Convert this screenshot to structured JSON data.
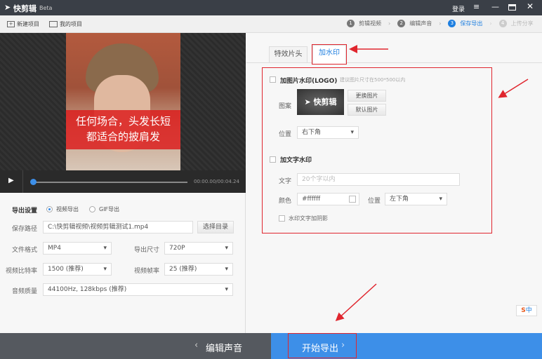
{
  "app": {
    "name": "快剪辑",
    "badge": "Beta",
    "login": "登录"
  },
  "toolbar": {
    "new_project": "新建项目",
    "my_projects": "我的项目"
  },
  "steps": [
    {
      "num": "1",
      "label": "剪辑视频"
    },
    {
      "num": "2",
      "label": "编辑声音"
    },
    {
      "num": "3",
      "label": "保存导出"
    },
    {
      "num": "4",
      "label": "上传分享"
    }
  ],
  "video": {
    "caption_line1": "任何场合，头发长短",
    "caption_line2": "都适合的披肩发",
    "time": "00:00.00/00:04.24",
    "progress": 0.01
  },
  "export": {
    "title": "导出设置",
    "radio_video": "视频导出",
    "radio_gif": "GIF导出",
    "path_label": "保存路径",
    "path_value": "C:\\快剪辑视频\\视频剪辑测试1.mp4",
    "choose_dir": "选择目录",
    "format_label": "文件格式",
    "format_value": "MP4",
    "size_label": "导出尺寸",
    "size_value": "720P",
    "bitrate_label": "视频比特率",
    "bitrate_value": "1500 (推荐)",
    "fps_label": "视频帧率",
    "fps_value": "25 (推荐)",
    "audio_label": "音频质量",
    "audio_value": "44100Hz, 128kbps (推荐)"
  },
  "tabs": [
    "特效片头",
    "加水印"
  ],
  "watermark": {
    "logo_title": "加图片水印(LOGO)",
    "logo_hint": "建议图片尺寸在500*500以内",
    "pattern_label": "图案",
    "logo_text": "快剪辑",
    "change_image": "更换图片",
    "default_image": "默认图片",
    "position_label": "位置",
    "position_value": "右下角",
    "text_title": "加文字水印",
    "text_label": "文字",
    "text_placeholder": "20个字以内",
    "color_label": "颜色",
    "color_value": "#ffffff",
    "text_position_label": "位置",
    "text_position_value": "左下角",
    "shadow_label": "水印文字加阴影"
  },
  "bottom": {
    "back": "编辑声音",
    "start": "开始导出"
  },
  "ime": {
    "label": "中"
  },
  "colors": {
    "accent": "#3d8fe8",
    "annotation": "#e0262e"
  }
}
